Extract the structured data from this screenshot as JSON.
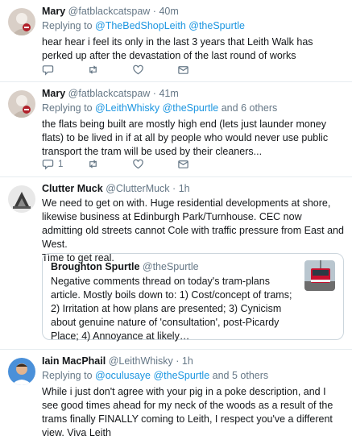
{
  "tweets": [
    {
      "name": "Mary",
      "handle": "@fatblackcatspaw",
      "dot": "·",
      "time": "40m",
      "replying_prefix": "Replying to",
      "reply_to": "@TheBedShopLeith @theSpurtle",
      "text": "hear hear i feel its only in the last 3 years that Leith Walk has perked up after the devastation of the last round of works",
      "likes": ""
    },
    {
      "name": "Mary",
      "handle": "@fatblackcatspaw",
      "dot": "·",
      "time": "41m",
      "replying_prefix": "Replying to",
      "reply_to": "@LeithWhisky @theSpurtle",
      "reply_suffix": "and 6 others",
      "text": "the flats being built are mostly high end (lets just launder money flats) to be lived in if at all by people who would never use public transport the tram will be used by their cleaners...",
      "replies": "1"
    },
    {
      "name": "Clutter Muck",
      "handle": "@ClutterMuck",
      "dot": "·",
      "time": "1h",
      "text": "We need to get on with. Huge residential developments at shore, likewise business at Edinburgh Park/Turnhouse. CEC now admitting old streets cannot Cole with traffic pressure from East and West.",
      "text2": "Time to get real.",
      "quote": {
        "name": "Broughton Spurtle",
        "handle": "@theSpurtle",
        "text": "Negative comments thread on today's tram-plans article. Mostly boils down to: 1) Cost/concept of trams; 2) Irritation at how plans are presented; 3) Cynicism about genuine nature of 'consultation', post-Picardy Place; 4) Annoyance at likely…"
      }
    },
    {
      "name": "Iain MacPhail",
      "handle": "@LeithWhisky",
      "dot": "·",
      "time": "1h",
      "replying_prefix": "Replying to",
      "reply_to": "@oculusaye @theSpurtle",
      "reply_suffix": "and 5 others",
      "text": "While i just don't agree with your pig in a poke description, and I see good times ahead for my neck of the woods as a result of the trams finally FINALLY coming to Leith, I respect you've a different view. Viva Leith"
    }
  ],
  "icons": {
    "reply": "reply-icon",
    "retweet": "retweet-icon",
    "like": "heart-icon",
    "dm": "envelope-icon"
  },
  "colors": {
    "link": "#1b95e0",
    "muted": "#657786",
    "border": "#e6ecf0"
  }
}
